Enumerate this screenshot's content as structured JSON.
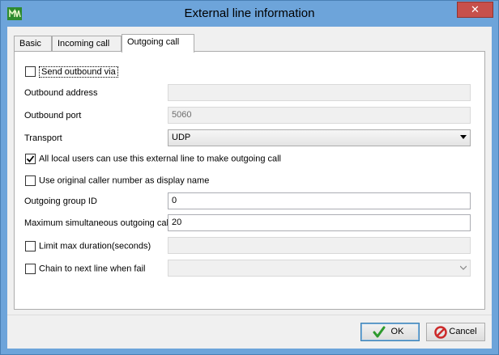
{
  "window": {
    "title": "External line information",
    "close_label": "✕"
  },
  "tabs": [
    {
      "label": "Basic"
    },
    {
      "label": "Incoming call"
    },
    {
      "label": "Outgoing call"
    }
  ],
  "form": {
    "send_outbound_via": {
      "label": "Send outbound via",
      "checked": false
    },
    "outbound_address": {
      "label": "Outbound address",
      "value": ""
    },
    "outbound_port": {
      "label": "Outbound port",
      "value": "5060"
    },
    "transport": {
      "label": "Transport",
      "value": "UDP"
    },
    "all_local_users": {
      "label": "All local users can use this external line to make outgoing call",
      "checked": true
    },
    "use_original_caller": {
      "label": "Use original caller number as display name",
      "checked": false
    },
    "outgoing_group_id": {
      "label": "Outgoing group ID",
      "value": "0"
    },
    "max_simultaneous": {
      "label": "Maximum simultaneous outgoing call",
      "value": "20"
    },
    "limit_max_duration": {
      "label": "Limit max duration(seconds)",
      "checked": false,
      "value": ""
    },
    "chain_next_line": {
      "label": "Chain to next line when fail",
      "checked": false,
      "value": ""
    }
  },
  "buttons": {
    "ok": "OK",
    "cancel": "Cancel"
  },
  "colors": {
    "frame": "#6da4da",
    "close": "#c7504b",
    "ok_check": "#2d9a2d",
    "cancel_icon": "#cc2a2a"
  }
}
